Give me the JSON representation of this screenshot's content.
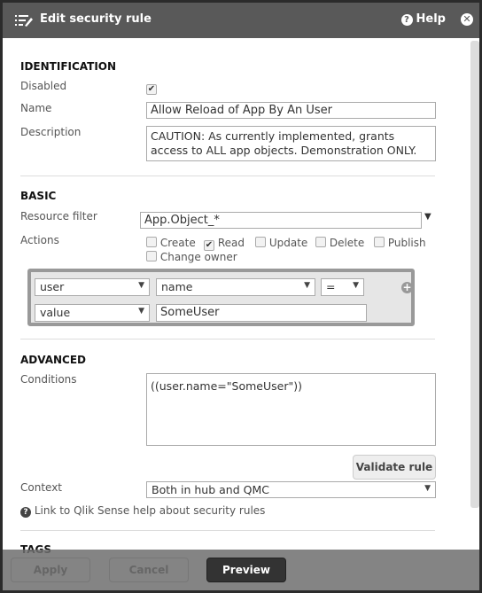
{
  "header": {
    "title": "Edit security rule",
    "help_label": "Help",
    "icon": "edit-list-icon",
    "close_icon": "close-circle-icon"
  },
  "identification": {
    "heading": "IDENTIFICATION",
    "disabled_label": "Disabled",
    "disabled_checked": true,
    "name_label": "Name",
    "name_value": "Allow Reload of App By An User",
    "description_label": "Description",
    "description_value": "CAUTION: As currently implemented, grants access to ALL app objects. Demonstration ONLY."
  },
  "basic": {
    "heading": "BASIC",
    "resource_filter_label": "Resource filter",
    "resource_filter_value": "App.Object_*",
    "actions_label": "Actions",
    "actions": [
      {
        "label": "Create",
        "checked": false
      },
      {
        "label": "Read",
        "checked": true
      },
      {
        "label": "Update",
        "checked": false
      },
      {
        "label": "Delete",
        "checked": false
      },
      {
        "label": "Publish",
        "checked": false
      },
      {
        "label": "Change owner",
        "checked": false
      }
    ],
    "condition": {
      "resource": "user",
      "property": "name",
      "operator": "=",
      "value_type": "value",
      "value": "SomeUser"
    }
  },
  "advanced": {
    "heading": "ADVANCED",
    "conditions_label": "Conditions",
    "conditions_value": "((user.name=\"SomeUser\"))",
    "validate_label": "Validate rule",
    "context_label": "Context",
    "context_value": "Both in hub and QMC",
    "help_link": "Link to Qlik Sense help about security rules"
  },
  "tags": {
    "heading": "TAGS"
  },
  "footer": {
    "apply": "Apply",
    "cancel": "Cancel",
    "preview": "Preview"
  }
}
